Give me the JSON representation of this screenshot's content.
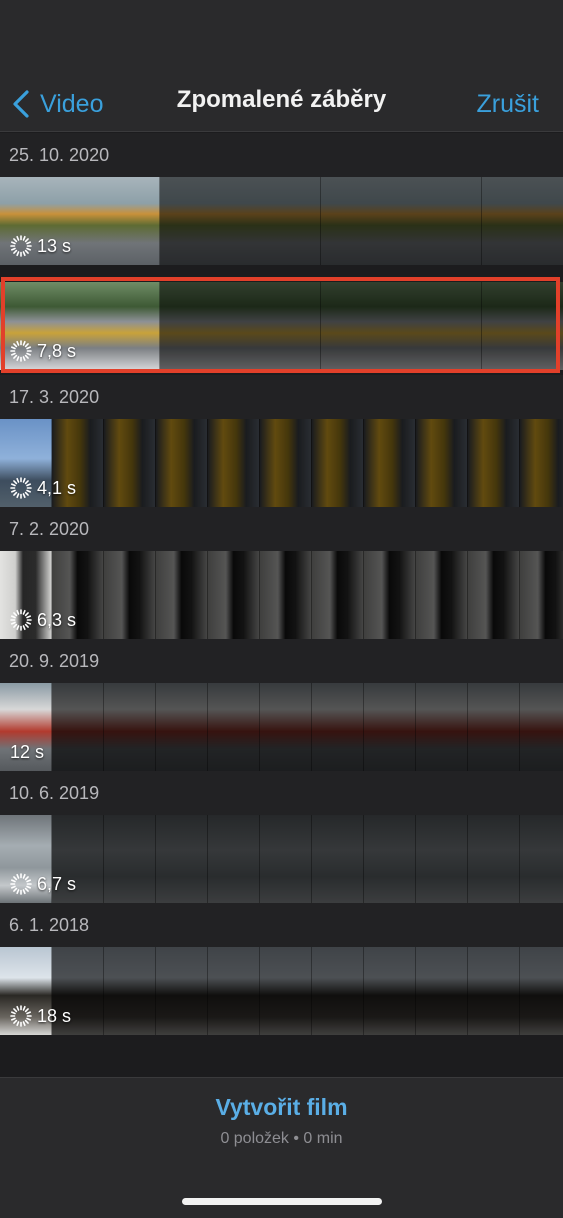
{
  "nav": {
    "back_label": "Video",
    "title": "Zpomalené záběry",
    "cancel_label": "Zrušit"
  },
  "sections": [
    {
      "date": "25. 10. 2020",
      "clips": [
        {
          "duration": "13 s",
          "slowmo": true,
          "selected": false,
          "frames": [
            "linear-gradient(180deg,#a8b4bb 0%,#8da0a8 30%,#c9913a 42%,#5e6b33 55%,#707478 75%,#5c6166 100%)"
          ]
        },
        {
          "duration": "7,8 s",
          "slowmo": true,
          "selected": true,
          "frames": [
            "linear-gradient(180deg,#6f8c66 0%,#3e5a35 28%,#8d9196 45%,#c9a23a 58%,#7b7f83 75%,#d6d7d9 100%)"
          ]
        }
      ]
    },
    {
      "date": "17. 3. 2020",
      "clips": [
        {
          "duration": "4,1 s",
          "slowmo": true,
          "selected": false,
          "frames": [
            "linear-gradient(180deg,#6a92c6 0%,#8fb1da 45%,#3d4d5e 70%,#52606b 100%)",
            "linear-gradient(90deg,#3a3e44 0%,#d9a521 30%,#9a7a1a 55%,#3a3e44 75%,#5c6470 100%)"
          ]
        }
      ]
    },
    {
      "date": "7. 2. 2020",
      "clips": [
        {
          "duration": "6,3 s",
          "slowmo": true,
          "selected": false,
          "frames": [
            "linear-gradient(90deg,#e3e3e1 0%,#cfcfcd 30%,#262626 45%,#2b2b2b 70%,#d0d0ce 100%)",
            "linear-gradient(90deg,#8c8c8a 0%,#bdbdbb 35%,#141414 50%,#2a2a2a 70%,#9a9a98 100%)"
          ]
        }
      ]
    },
    {
      "date": "20. 9. 2019",
      "clips": [
        {
          "duration": "12 s",
          "slowmo": false,
          "selected": false,
          "frames": [
            "linear-gradient(180deg,#8a9aa4 0%,#d8d8d8 30%,#b23a2e 55%,#6f7377 75%,#55595d 100%)",
            "linear-gradient(180deg,#7a8288 0%,#bcbcbc 30%,#7a2a22 55%,#4b4f53 75%,#3e4145 100%)"
          ]
        }
      ]
    },
    {
      "date": "10. 6. 2019",
      "clips": [
        {
          "duration": "6,7 s",
          "slowmo": true,
          "selected": false,
          "frames": [
            "linear-gradient(180deg,#6f757a 0%,#a5adb2 35%,#8f979c 60%,#c4c8cb 80%,#6d7377 100%)",
            "linear-gradient(180deg,#54595d 0%,#777d81 40%,#5c6266 70%,#85898c 100%)"
          ]
        }
      ]
    },
    {
      "date": "6. 1. 2018",
      "clips": [
        {
          "duration": "18 s",
          "slowmo": true,
          "selected": false,
          "frames": [
            "linear-gradient(180deg,#b9c6d2 0%,#dde4ea 35%,#2a2824 55%,#6a6660 80%,#d6d6d4 100%)",
            "linear-gradient(180deg,#8d96a0 0%,#aab2ba 35%,#23211e 55%,#3b3733 80%,#8c8c8a 100%)"
          ]
        }
      ]
    }
  ],
  "bottom": {
    "create_label": "Vytvořit film",
    "summary": "0 položek • 0 min"
  },
  "colors": {
    "accent": "#3aa0dc",
    "selection": "#e2402a",
    "background": "#1c1c1e",
    "bar": "#2a2a2c"
  }
}
